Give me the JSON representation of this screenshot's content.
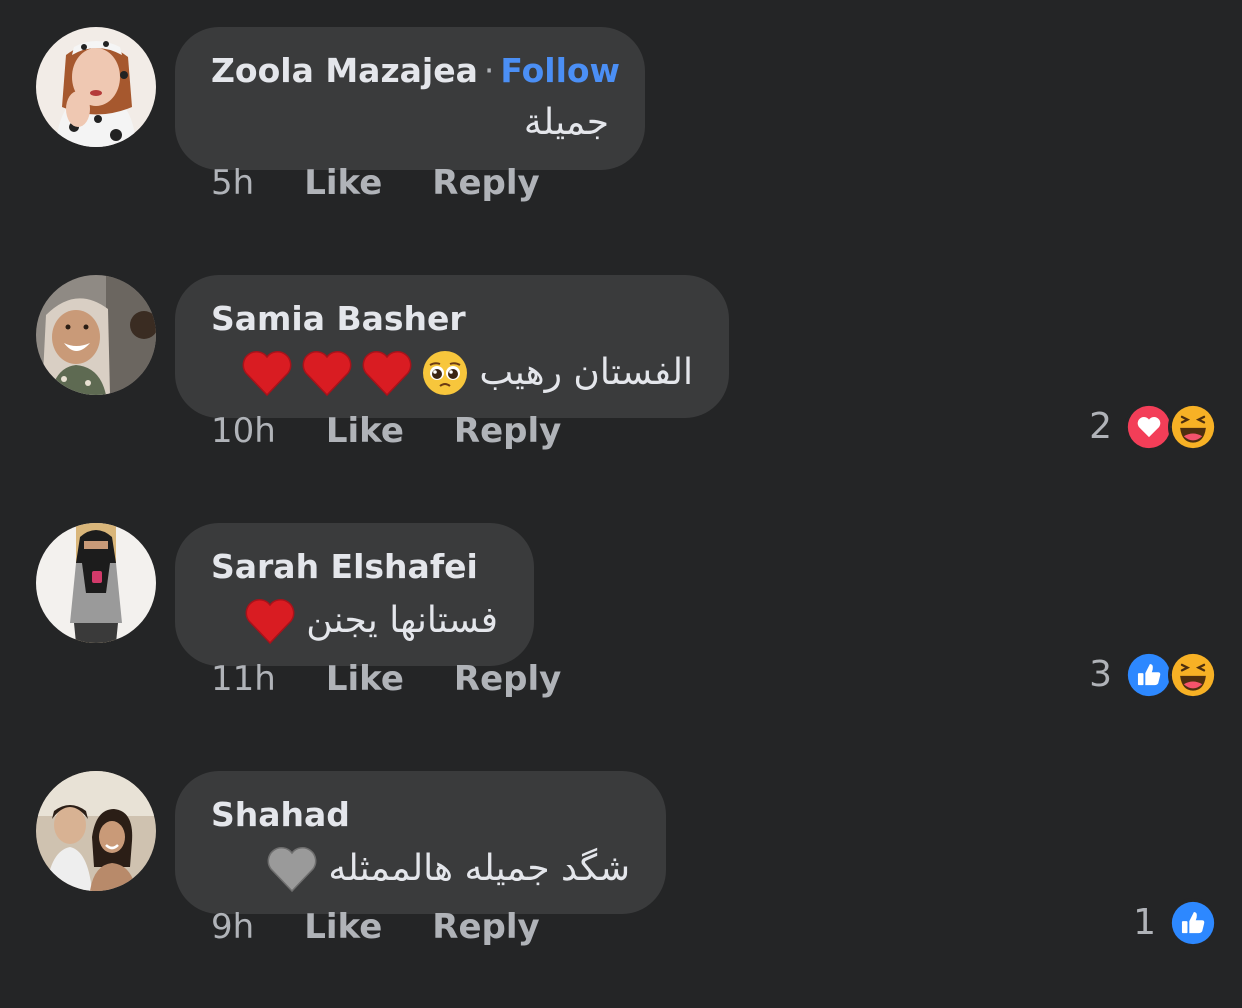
{
  "comments": [
    {
      "author": "Zoola Mazajea",
      "separator": "·",
      "follow_label": "Follow",
      "text": "جميلة",
      "emojis": [],
      "time": "5h",
      "like_label": "Like",
      "reply_label": "Reply",
      "reaction_count": "",
      "reactions": []
    },
    {
      "author": "Samia Basher",
      "text": "الفستان رهيب",
      "emojis": [
        "pleading-face-emoji",
        "red-heart-emoji",
        "red-heart-emoji",
        "red-heart-emoji"
      ],
      "time": "10h",
      "like_label": "Like",
      "reply_label": "Reply",
      "reaction_count": "2",
      "reactions": [
        "love-reaction-icon",
        "haha-reaction-icon"
      ]
    },
    {
      "author": "Sarah Elshafei",
      "text": "فستانها يجنن",
      "emojis": [
        "red-heart-emoji"
      ],
      "time": "11h",
      "like_label": "Like",
      "reply_label": "Reply",
      "reaction_count": "3",
      "reactions": [
        "like-reaction-icon",
        "haha-reaction-icon"
      ]
    },
    {
      "author": "Shahad",
      "text": "شگد جميله هالممثله",
      "emojis": [
        "grey-heart-emoji"
      ],
      "time": "9h",
      "like_label": "Like",
      "reply_label": "Reply",
      "reaction_count": "1",
      "reactions": [
        "like-reaction-icon"
      ]
    }
  ],
  "colors": {
    "background": "#242526",
    "bubble": "#3a3b3c",
    "primary_text": "#e4e6eb",
    "secondary_text": "#b0b3b8",
    "follow_link": "#4b8ff5",
    "like_blue": "#2d88ff",
    "love_red": "#f33e58",
    "haha_yellow": "#f7b125",
    "heart_red": "#d91c22",
    "heart_grey": "#9a9a9a"
  }
}
